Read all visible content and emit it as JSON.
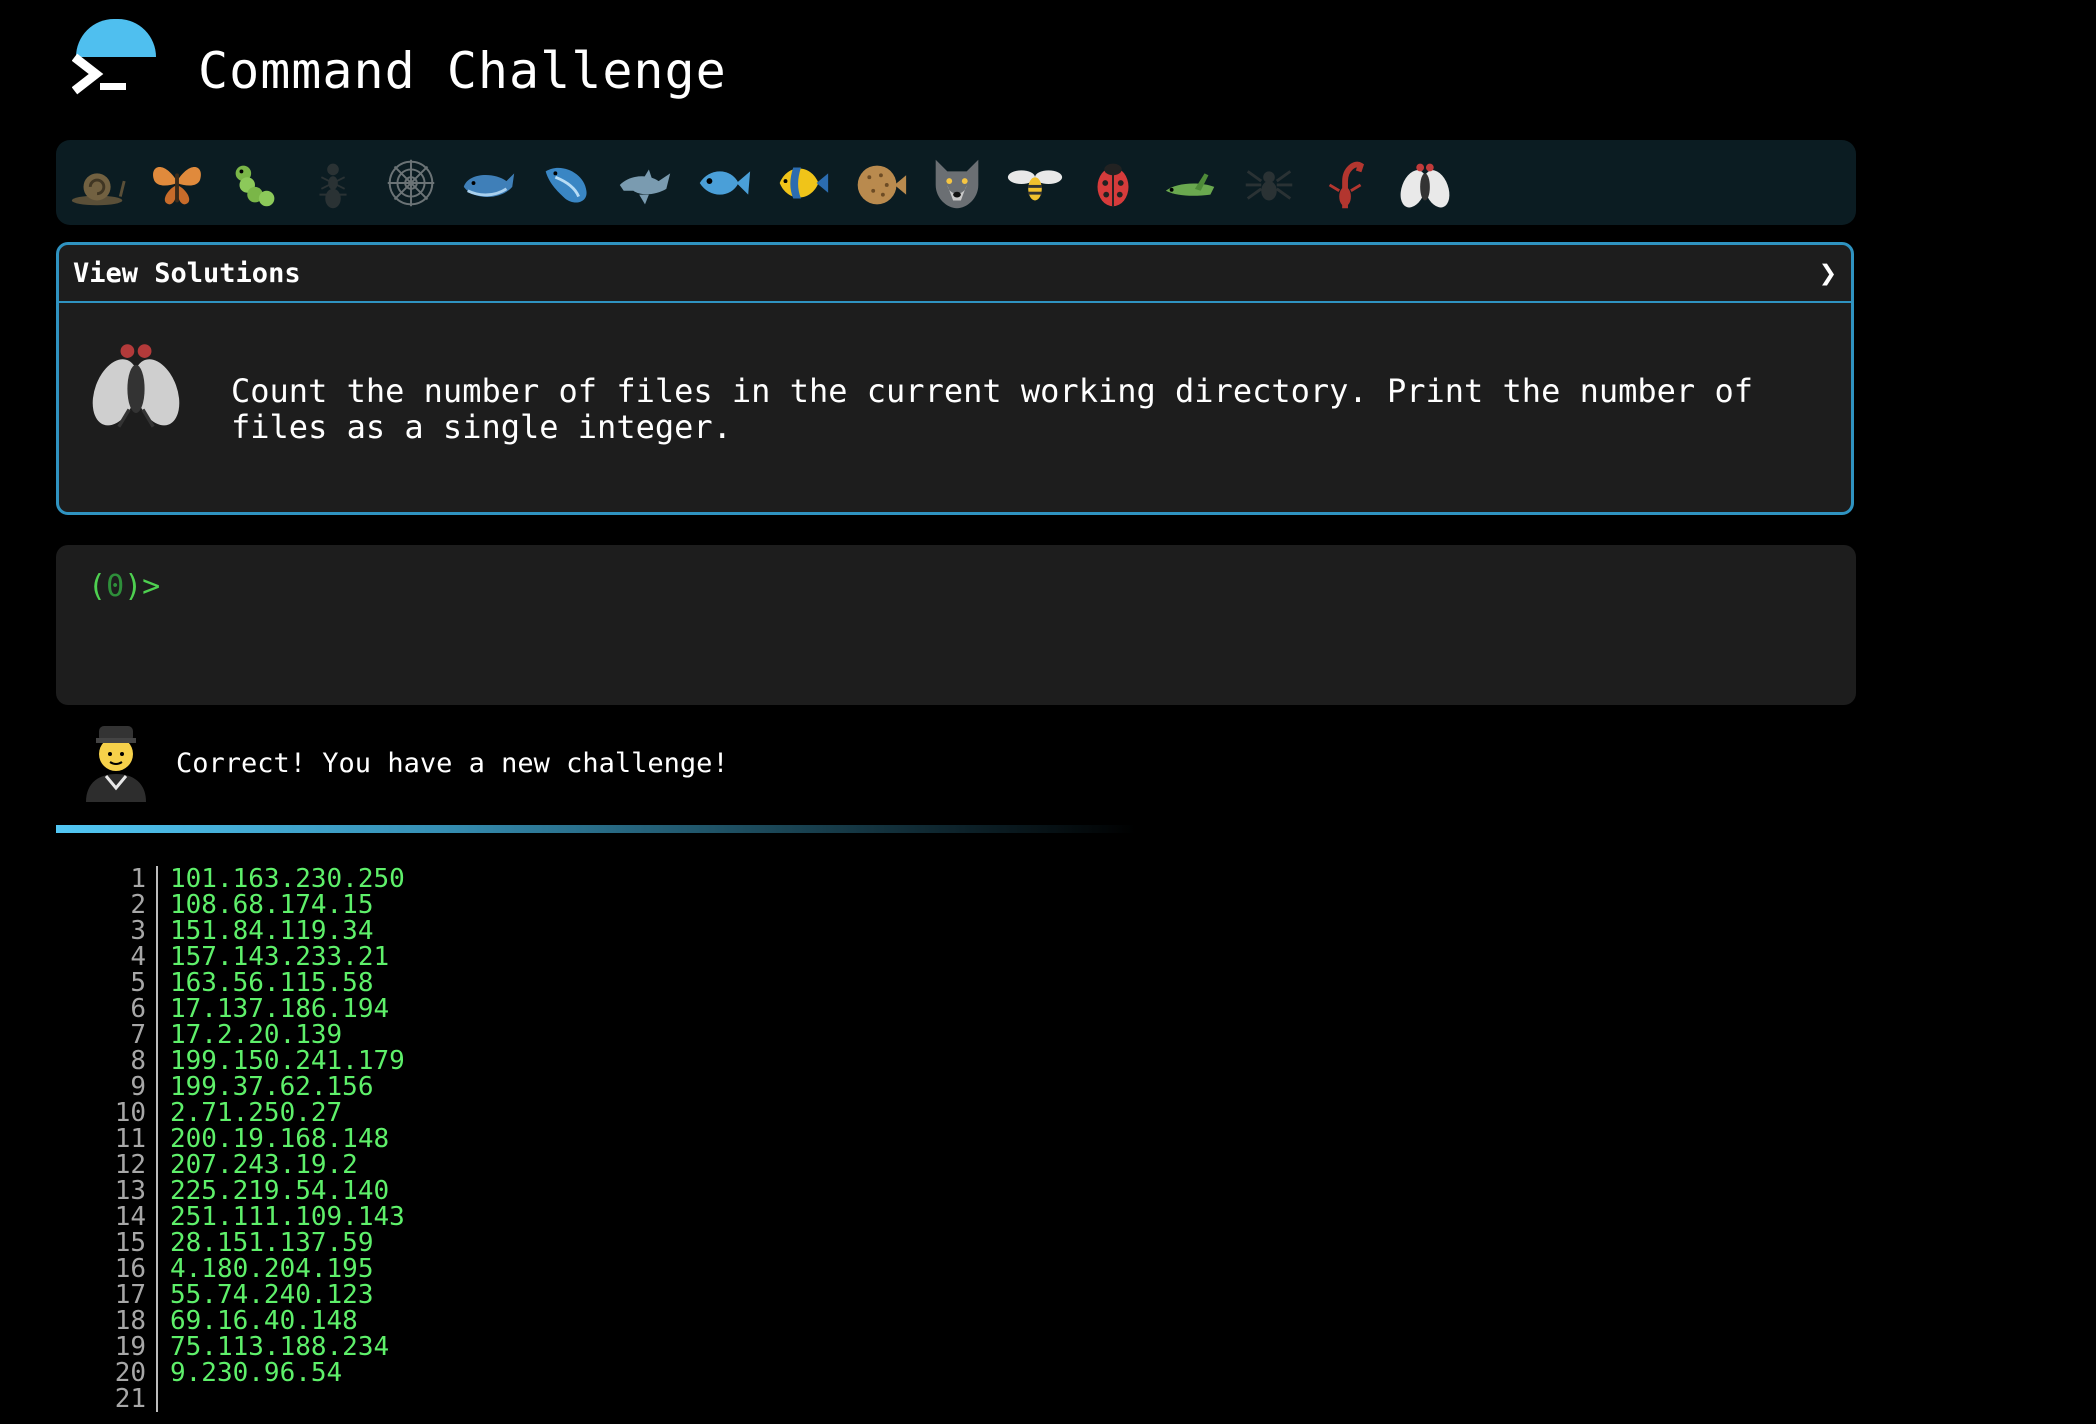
{
  "app": {
    "title": "Command Challenge",
    "logo_icon": "terminal-prompt-icon",
    "accent_color": "#4fbfef"
  },
  "challenge_icons": [
    {
      "name": "snail-icon",
      "completed": true
    },
    {
      "name": "butterfly-icon",
      "completed": true
    },
    {
      "name": "caterpillar-icon",
      "completed": true
    },
    {
      "name": "ant-icon",
      "completed": true
    },
    {
      "name": "spider-web-icon",
      "completed": true
    },
    {
      "name": "whale-icon",
      "completed": true
    },
    {
      "name": "whale-2-icon",
      "completed": true
    },
    {
      "name": "dolphin-icon",
      "completed": true
    },
    {
      "name": "fish-icon",
      "completed": true
    },
    {
      "name": "tropical-fish-icon",
      "completed": true
    },
    {
      "name": "blowfish-icon",
      "completed": true
    },
    {
      "name": "wolf-icon",
      "completed": true
    },
    {
      "name": "bee-icon",
      "completed": true
    },
    {
      "name": "ladybug-icon",
      "completed": true
    },
    {
      "name": "cricket-icon",
      "completed": true
    },
    {
      "name": "spider-icon",
      "completed": true
    },
    {
      "name": "scorpion-icon",
      "completed": true
    },
    {
      "name": "fly-icon",
      "completed": false,
      "current": true
    }
  ],
  "solutions": {
    "label": "View Solutions",
    "chevron": "❯"
  },
  "challenge": {
    "icon": "fly-icon",
    "text": "Count the number of files in the current working directory. Print the number of\nfiles as a single integer."
  },
  "terminal": {
    "prompt_open": "(",
    "prompt_count": "0",
    "prompt_close": ")>",
    "input_value": ""
  },
  "feedback": {
    "avatar": "guide-avatar-icon",
    "message": "Correct! You have a new challenge!"
  },
  "progress": {
    "fraction": 0.6
  },
  "output": {
    "lines": [
      {
        "num": "1",
        "text": "101.163.230.250"
      },
      {
        "num": "2",
        "text": "108.68.174.15"
      },
      {
        "num": "3",
        "text": "151.84.119.34"
      },
      {
        "num": "4",
        "text": "157.143.233.21"
      },
      {
        "num": "5",
        "text": "163.56.115.58"
      },
      {
        "num": "6",
        "text": "17.137.186.194"
      },
      {
        "num": "7",
        "text": "17.2.20.139"
      },
      {
        "num": "8",
        "text": "199.150.241.179"
      },
      {
        "num": "9",
        "text": "199.37.62.156"
      },
      {
        "num": "10",
        "text": "2.71.250.27"
      },
      {
        "num": "11",
        "text": "200.19.168.148"
      },
      {
        "num": "12",
        "text": "207.243.19.2"
      },
      {
        "num": "13",
        "text": "225.219.54.140"
      },
      {
        "num": "14",
        "text": "251.111.109.143"
      },
      {
        "num": "15",
        "text": "28.151.137.59"
      },
      {
        "num": "16",
        "text": "4.180.204.195"
      },
      {
        "num": "17",
        "text": "55.74.240.123"
      },
      {
        "num": "18",
        "text": "69.16.40.148"
      },
      {
        "num": "19",
        "text": "75.113.188.234"
      },
      {
        "num": "20",
        "text": "9.230.96.54"
      },
      {
        "num": "21",
        "text": ""
      }
    ]
  }
}
